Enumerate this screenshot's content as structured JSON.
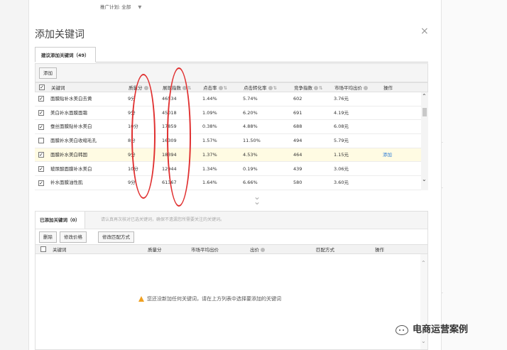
{
  "top_filter": {
    "label": "推广计划:",
    "value": "全部"
  },
  "dialog": {
    "title": "添加关键词",
    "close": "×"
  },
  "suggest": {
    "tab_label": "建议添加关键词（49）",
    "add_button": "添加",
    "columns": [
      {
        "label": "关键词"
      },
      {
        "label": "质量分",
        "help": true
      },
      {
        "label": "展现指数",
        "help": true,
        "sort": "⇅"
      },
      {
        "label": "点击率",
        "help": true,
        "sort": "⇅"
      },
      {
        "label": "点击转化率",
        "help": true,
        "sort": "⇅"
      },
      {
        "label": "竞争指数",
        "help": true,
        "sort": "⇅"
      },
      {
        "label": "市场平均出价",
        "help": true
      },
      {
        "label": "操作"
      }
    ],
    "rows": [
      {
        "checked": true,
        "keyword": "面膜贴补水美白去黄",
        "quality": "9分",
        "impressions": "46534",
        "ctr": "1.44%",
        "cvr": "5.74%",
        "competition": "602",
        "avg_bid": "3.76元",
        "action": "",
        "highlight": false
      },
      {
        "checked": true,
        "keyword": "美白补水面膜面霜",
        "quality": "9分",
        "impressions": "45018",
        "ctr": "1.09%",
        "cvr": "6.20%",
        "competition": "691",
        "avg_bid": "4.19元",
        "action": "",
        "highlight": false
      },
      {
        "checked": true,
        "keyword": "蚕丝面膜贴补水美白",
        "quality": "10分",
        "impressions": "17859",
        "ctr": "0.38%",
        "cvr": "4.88%",
        "competition": "688",
        "avg_bid": "6.08元",
        "action": "",
        "highlight": false
      },
      {
        "checked": false,
        "keyword": "面膜补水美白收缩毛孔",
        "quality": "8分",
        "impressions": "16309",
        "ctr": "1.57%",
        "cvr": "11.50%",
        "competition": "494",
        "avg_bid": "5.79元",
        "action": "",
        "highlight": false
      },
      {
        "checked": true,
        "keyword": "面膜补水美白韩国",
        "quality": "9分",
        "impressions": "18394",
        "ctr": "1.37%",
        "cvr": "4.53%",
        "competition": "464",
        "avg_bid": "1.15元",
        "action": "添加",
        "highlight": true
      },
      {
        "checked": true,
        "keyword": "玻尿酸面膜补水美白",
        "quality": "10分",
        "impressions": "12944",
        "ctr": "1.34%",
        "cvr": "0.19%",
        "competition": "439",
        "avg_bid": "3.06元",
        "action": "",
        "highlight": false
      },
      {
        "checked": true,
        "keyword": "补水面膜油性肌",
        "quality": "9分",
        "impressions": "61367",
        "ctr": "1.64%",
        "cvr": "6.66%",
        "competition": "580",
        "avg_bid": "3.60元",
        "action": "",
        "highlight": false
      }
    ]
  },
  "added": {
    "tab_label": "已添加关键词（0）",
    "hint": "请认真再次核对已选关键词，确保不遗漏您所需要关注的关键词。",
    "buttons": {
      "delete": "删除",
      "edit_price": "修改价格",
      "edit_match": "修改匹配方式"
    },
    "columns": [
      "关键词",
      "质量分",
      "市场平均出价",
      "出价",
      "匹配方式",
      "操作"
    ],
    "empty_message": "您还没新加任何关键词，请在上方列表中选择要添加的关键词"
  },
  "watermark": "电商运营案例",
  "colors": {
    "annotation": "#e03030",
    "link": "#2b7bd6",
    "highlight_row": "#fffbe3",
    "warn": "#f0a020"
  }
}
